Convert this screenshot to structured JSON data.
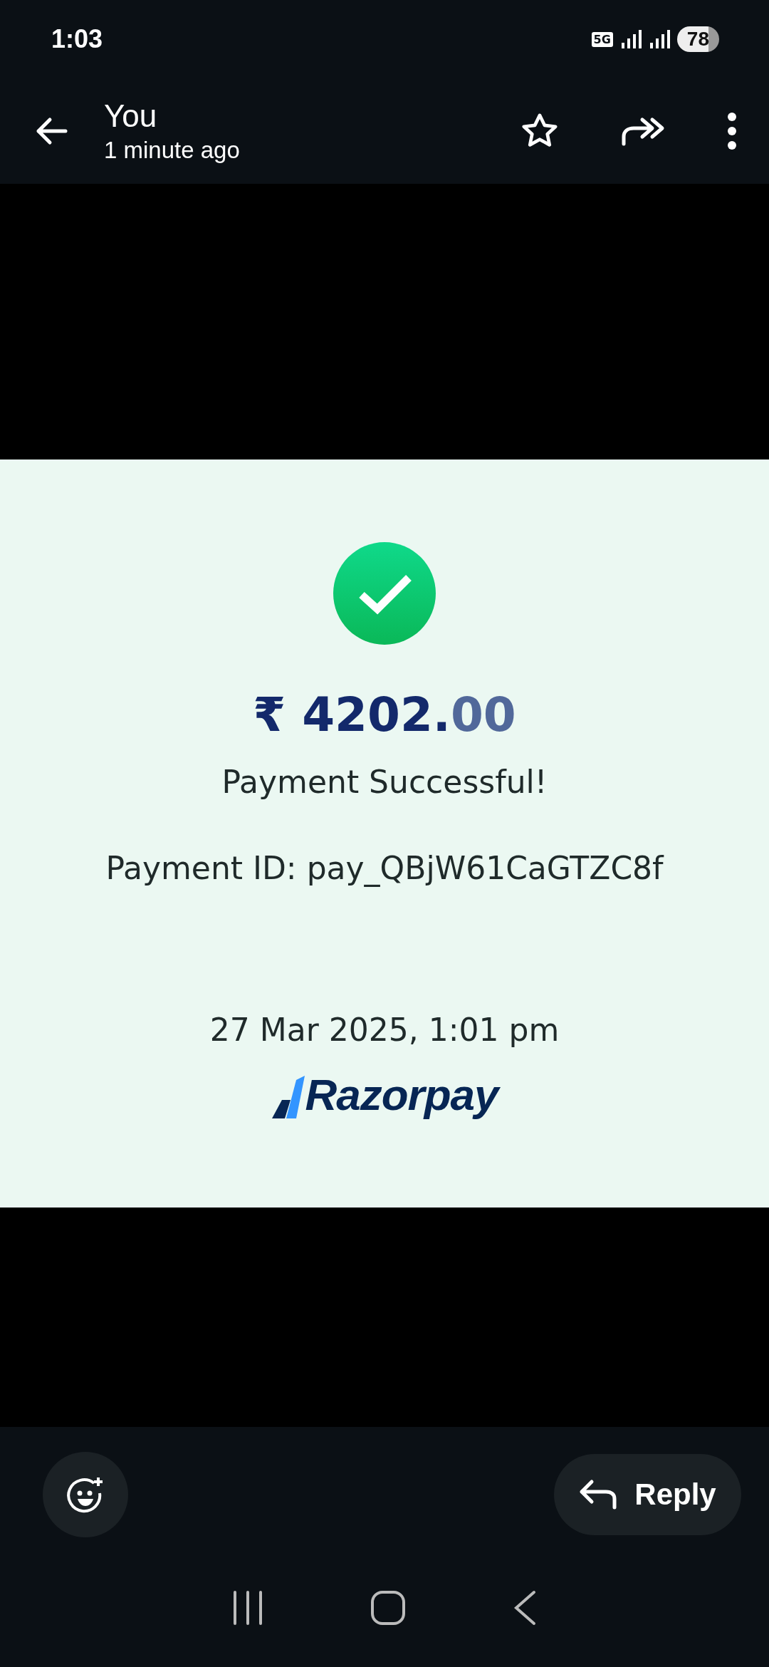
{
  "status_bar": {
    "time": "1:03",
    "network": "5G",
    "battery": "78"
  },
  "header": {
    "sender": "You",
    "time": "1 minute ago",
    "starred": false
  },
  "receipt": {
    "amount_main": "₹ 4202.",
    "amount_decimals": "00",
    "status": "Payment Successful!",
    "payment_id": "Payment ID: pay_QBjW61CaGTZC8f",
    "date": "27 Mar 2025, 1:01 pm",
    "brand": "Razorpay"
  },
  "actions": {
    "reply": "Reply"
  }
}
